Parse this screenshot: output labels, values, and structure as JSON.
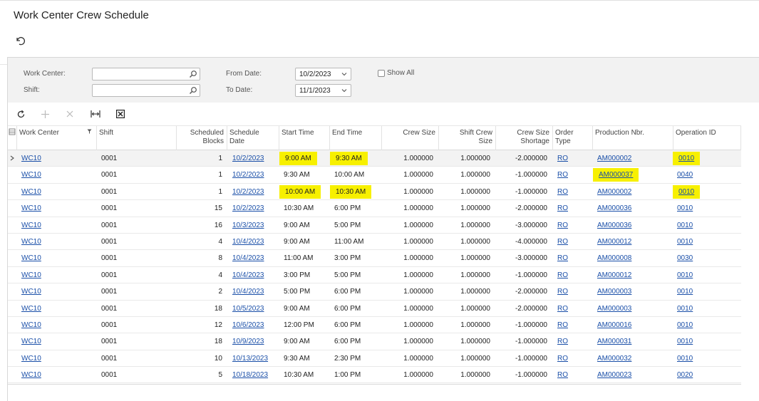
{
  "page": {
    "title": "Work Center Crew Schedule"
  },
  "icons": {
    "undo": "undo-icon",
    "search": "search-icon",
    "chevron": "chevron-down-icon",
    "refresh": "refresh-icon",
    "add": "plus-icon",
    "delete": "x-icon",
    "fit": "fit-columns-icon",
    "excel": "excel-export-icon"
  },
  "colors": {
    "link": "#1a4fa8",
    "highlight": "#f7f000"
  },
  "filters": {
    "work_center_label": "Work Center:",
    "work_center_value": "",
    "shift_label": "Shift:",
    "shift_value": "",
    "from_date_label": "From Date:",
    "from_date_value": "10/2/2023",
    "to_date_label": "To Date:",
    "to_date_value": "11/1/2023",
    "show_all_label": "Show All",
    "show_all_checked": false
  },
  "grid": {
    "columns": {
      "work_center": "Work Center",
      "shift": "Shift",
      "scheduled_blocks": [
        "Scheduled",
        "Blocks"
      ],
      "schedule_date": [
        "Schedule",
        "Date"
      ],
      "start_time": "Start Time",
      "end_time": "End Time",
      "crew_size": "Crew Size",
      "shift_crew_size": [
        "Shift Crew",
        "Size"
      ],
      "crew_size_shortage": [
        "Crew Size",
        "Shortage"
      ],
      "order_type": [
        "Order",
        "Type"
      ],
      "production_nbr": "Production Nbr.",
      "operation_id": "Operation ID"
    },
    "rows": [
      {
        "work_center": "WC10",
        "shift": "0001",
        "blocks": "1",
        "date": "10/2/2023",
        "start": "9:00 AM",
        "end": "9:30 AM",
        "crew": "1.000000",
        "shift_crew": "1.000000",
        "shortage": "-2.000000",
        "order_type": "RO",
        "prod": "AM000002",
        "op": "0010"
      },
      {
        "work_center": "WC10",
        "shift": "0001",
        "blocks": "1",
        "date": "10/2/2023",
        "start": "9:30 AM",
        "end": "10:00 AM",
        "crew": "1.000000",
        "shift_crew": "1.000000",
        "shortage": "-1.000000",
        "order_type": "RO",
        "prod": "AM000037",
        "op": "0040"
      },
      {
        "work_center": "WC10",
        "shift": "0001",
        "blocks": "1",
        "date": "10/2/2023",
        "start": "10:00 AM",
        "end": "10:30 AM",
        "crew": "1.000000",
        "shift_crew": "1.000000",
        "shortage": "-1.000000",
        "order_type": "RO",
        "prod": "AM000002",
        "op": "0010"
      },
      {
        "work_center": "WC10",
        "shift": "0001",
        "blocks": "15",
        "date": "10/2/2023",
        "start": "10:30 AM",
        "end": "6:00 PM",
        "crew": "1.000000",
        "shift_crew": "1.000000",
        "shortage": "-2.000000",
        "order_type": "RO",
        "prod": "AM000036",
        "op": "0010"
      },
      {
        "work_center": "WC10",
        "shift": "0001",
        "blocks": "16",
        "date": "10/3/2023",
        "start": "9:00 AM",
        "end": "5:00 PM",
        "crew": "1.000000",
        "shift_crew": "1.000000",
        "shortage": "-3.000000",
        "order_type": "RO",
        "prod": "AM000036",
        "op": "0010"
      },
      {
        "work_center": "WC10",
        "shift": "0001",
        "blocks": "4",
        "date": "10/4/2023",
        "start": "9:00 AM",
        "end": "11:00 AM",
        "crew": "1.000000",
        "shift_crew": "1.000000",
        "shortage": "-4.000000",
        "order_type": "RO",
        "prod": "AM000012",
        "op": "0010"
      },
      {
        "work_center": "WC10",
        "shift": "0001",
        "blocks": "8",
        "date": "10/4/2023",
        "start": "11:00 AM",
        "end": "3:00 PM",
        "crew": "1.000000",
        "shift_crew": "1.000000",
        "shortage": "-3.000000",
        "order_type": "RO",
        "prod": "AM000008",
        "op": "0030"
      },
      {
        "work_center": "WC10",
        "shift": "0001",
        "blocks": "4",
        "date": "10/4/2023",
        "start": "3:00 PM",
        "end": "5:00 PM",
        "crew": "1.000000",
        "shift_crew": "1.000000",
        "shortage": "-1.000000",
        "order_type": "RO",
        "prod": "AM000012",
        "op": "0010"
      },
      {
        "work_center": "WC10",
        "shift": "0001",
        "blocks": "2",
        "date": "10/4/2023",
        "start": "5:00 PM",
        "end": "6:00 PM",
        "crew": "1.000000",
        "shift_crew": "1.000000",
        "shortage": "-2.000000",
        "order_type": "RO",
        "prod": "AM000003",
        "op": "0010"
      },
      {
        "work_center": "WC10",
        "shift": "0001",
        "blocks": "18",
        "date": "10/5/2023",
        "start": "9:00 AM",
        "end": "6:00 PM",
        "crew": "1.000000",
        "shift_crew": "1.000000",
        "shortage": "-2.000000",
        "order_type": "RO",
        "prod": "AM000003",
        "op": "0010"
      },
      {
        "work_center": "WC10",
        "shift": "0001",
        "blocks": "12",
        "date": "10/6/2023",
        "start": "12:00 PM",
        "end": "6:00 PM",
        "crew": "1.000000",
        "shift_crew": "1.000000",
        "shortage": "-1.000000",
        "order_type": "RO",
        "prod": "AM000016",
        "op": "0010"
      },
      {
        "work_center": "WC10",
        "shift": "0001",
        "blocks": "18",
        "date": "10/9/2023",
        "start": "9:00 AM",
        "end": "6:00 PM",
        "crew": "1.000000",
        "shift_crew": "1.000000",
        "shortage": "-1.000000",
        "order_type": "RO",
        "prod": "AM000031",
        "op": "0010"
      },
      {
        "work_center": "WC10",
        "shift": "0001",
        "blocks": "10",
        "date": "10/13/2023",
        "start": "9:30 AM",
        "end": "2:30 PM",
        "crew": "1.000000",
        "shift_crew": "1.000000",
        "shortage": "-1.000000",
        "order_type": "RO",
        "prod": "AM000032",
        "op": "0010"
      },
      {
        "work_center": "WC10",
        "shift": "0001",
        "blocks": "5",
        "date": "10/18/2023",
        "start": "10:30 AM",
        "end": "1:00 PM",
        "crew": "1.000000",
        "shift_crew": "1.000000",
        "shortage": "-1.000000",
        "order_type": "RO",
        "prod": "AM000023",
        "op": "0020"
      }
    ],
    "highlights": [
      {
        "row": 0,
        "cols": [
          "start",
          "end",
          "op"
        ]
      },
      {
        "row": 1,
        "cols": [
          "prod"
        ]
      },
      {
        "row": 2,
        "cols": [
          "start",
          "end",
          "op"
        ]
      }
    ]
  }
}
